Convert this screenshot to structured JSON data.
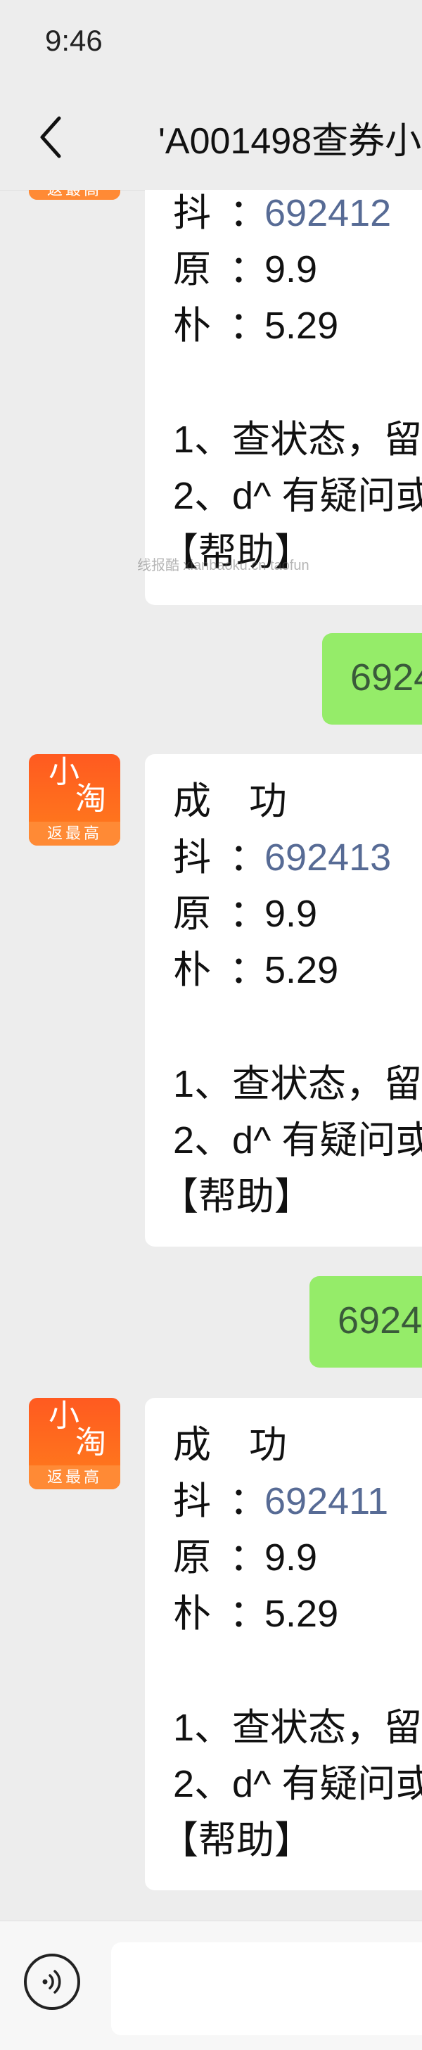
{
  "status": {
    "time": "9:46"
  },
  "nav": {
    "back_icon": "chevron-left-icon",
    "title": "'A001498查券小"
  },
  "watermark": "线报酷 xianbaoku.cn taofun",
  "chat": {
    "bot_name_lines": [
      "小",
      "淘"
    ],
    "bot_ribbon": "返最高",
    "messages": [
      {
        "type": "received",
        "success": "",
        "dou_label": "抖",
        "dou_value": "692412",
        "yuan_label": "原",
        "yuan_value": "9.9",
        "pu_label": "朴",
        "pu_value": "5.29",
        "tip1": "1、查状态，留",
        "tip2": "2、d^ 有疑问或",
        "help": "【帮助】"
      },
      {
        "type": "sent",
        "text": "6924"
      },
      {
        "type": "received",
        "success": "成　功",
        "dou_label": "抖",
        "dou_value": "692413",
        "yuan_label": "原",
        "yuan_value": "9.9",
        "pu_label": "朴",
        "pu_value": "5.29",
        "tip1": "1、查状态，留",
        "tip2": "2、d^ 有疑问或",
        "help": "【帮助】"
      },
      {
        "type": "sent",
        "text": "6924"
      },
      {
        "type": "received",
        "success": "成　功",
        "dou_label": "抖",
        "dou_value": "692411",
        "yuan_label": "原",
        "yuan_value": "9.9",
        "pu_label": "朴",
        "pu_value": "5.29",
        "tip1": "1、查状态，留",
        "tip2": "2、d^ 有疑问或",
        "help": "【帮助】"
      }
    ],
    "colon": "："
  },
  "input": {
    "voice_icon": "voice-input-icon"
  }
}
